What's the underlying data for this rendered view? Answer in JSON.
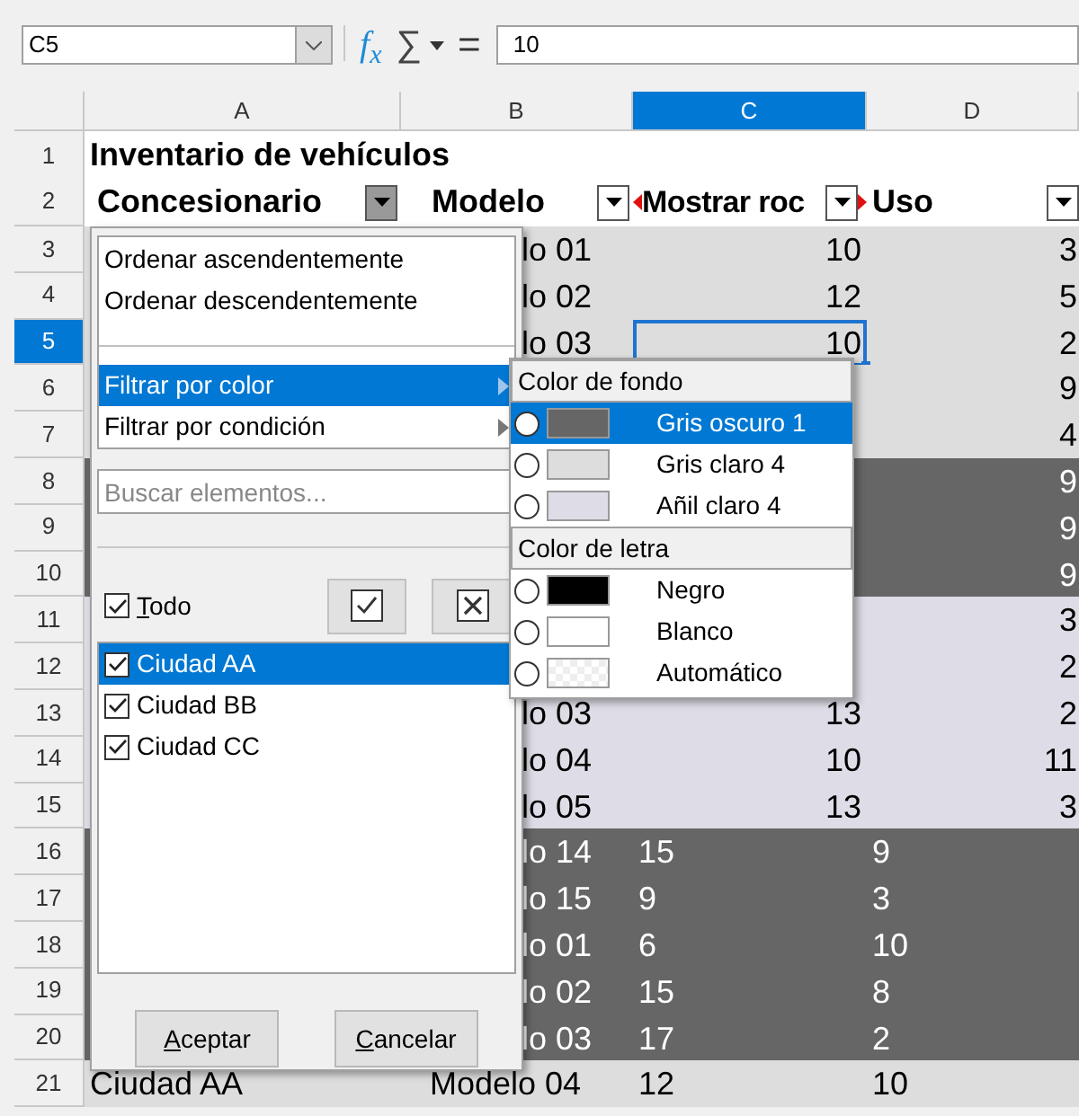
{
  "formula_bar": {
    "cell_ref": "C5",
    "function_label": "f$_{x}$",
    "sum_symbol": "∑",
    "equals_symbol": "=",
    "value": "10"
  },
  "columns": [
    {
      "label": "A",
      "selected": false
    },
    {
      "label": "B",
      "selected": false
    },
    {
      "label": "C",
      "selected": true
    },
    {
      "label": "D",
      "selected": false
    }
  ],
  "title_row": {
    "number": "1",
    "text": "Inventario de vehículos"
  },
  "header_row": {
    "number": "2",
    "headers": [
      {
        "label": "Concesionario",
        "filter_active": true
      },
      {
        "label": "Modelo",
        "filter_active": false
      },
      {
        "label": "Mostrar roc",
        "filter_active": false
      },
      {
        "label": "Uso",
        "filter_active": false
      }
    ]
  },
  "rows": [
    {
      "number": "3",
      "selected": false,
      "color": "#dddddd",
      "kind": "numeric",
      "cells": {
        "b": "lo 01",
        "c": "10",
        "d": "3"
      }
    },
    {
      "number": "4",
      "selected": false,
      "color": "#dddddd",
      "kind": "numeric",
      "cells": {
        "b": "lo 02",
        "c": "12",
        "d": "5"
      }
    },
    {
      "number": "5",
      "selected": true,
      "color": "#dddddd",
      "kind": "numeric",
      "cells": {
        "b": "lo 03",
        "c": "10",
        "d": "2"
      }
    },
    {
      "number": "6",
      "selected": false,
      "color": "#dddddd",
      "kind": "numeric",
      "cells": {
        "d": "9"
      }
    },
    {
      "number": "7",
      "selected": false,
      "color": "#dddddd",
      "kind": "numeric",
      "cells": {
        "d": "4"
      }
    },
    {
      "number": "8",
      "selected": false,
      "color": "#666666",
      "kind": "numeric",
      "cells": {
        "d": "9"
      }
    },
    {
      "number": "9",
      "selected": false,
      "color": "#666666",
      "kind": "numeric",
      "cells": {
        "d": "9"
      }
    },
    {
      "number": "10",
      "selected": false,
      "color": "#666666",
      "kind": "numeric",
      "cells": {
        "d": "9"
      }
    },
    {
      "number": "11",
      "selected": false,
      "color": "#dedce6",
      "kind": "numeric",
      "cells": {
        "d": "3"
      }
    },
    {
      "number": "12",
      "selected": false,
      "color": "#dedce6",
      "kind": "numeric",
      "cells": {
        "d": "2"
      }
    },
    {
      "number": "13",
      "selected": false,
      "color": "#dedce6",
      "kind": "numeric",
      "cells": {
        "b": "lo 03",
        "c": "13",
        "d": "2"
      }
    },
    {
      "number": "14",
      "selected": false,
      "color": "#dedce6",
      "kind": "numeric",
      "cells": {
        "b": "lo 04",
        "c": "10",
        "d": "11"
      }
    },
    {
      "number": "15",
      "selected": false,
      "color": "#dedce6",
      "kind": "numeric",
      "cells": {
        "b": "lo 05",
        "c": "13",
        "d": "3"
      }
    },
    {
      "number": "16",
      "selected": false,
      "color": "#666666",
      "kind": "text",
      "cells": {
        "b": "lo 14",
        "c": "15",
        "d": "9"
      }
    },
    {
      "number": "17",
      "selected": false,
      "color": "#666666",
      "kind": "text",
      "cells": {
        "b": "lo 15",
        "c": "9",
        "d": "3"
      }
    },
    {
      "number": "18",
      "selected": false,
      "color": "#666666",
      "kind": "text",
      "cells": {
        "b": "lo 01",
        "c": "6",
        "d": "10"
      }
    },
    {
      "number": "19",
      "selected": false,
      "color": "#666666",
      "kind": "text",
      "cells": {
        "b": "lo 02",
        "c": "15",
        "d": "8"
      }
    },
    {
      "number": "20",
      "selected": false,
      "color": "#666666",
      "kind": "text",
      "cells": {
        "b": "lo 03",
        "c": "17",
        "d": "2"
      }
    },
    {
      "number": "21",
      "selected": false,
      "color": "#dddddd",
      "kind": "text",
      "cells": {
        "a": "Ciudad AA",
        "b": "Modelo 04",
        "c": "12",
        "d": "10"
      }
    }
  ],
  "filter_popup": {
    "sort_items": [
      {
        "label": "Ordenar ascendentemente",
        "selected": false
      },
      {
        "label": "Ordenar descendentemente",
        "selected": false
      }
    ],
    "filter_items": [
      {
        "label": "Filtrar por color",
        "selected": true
      },
      {
        "label": "Filtrar por condición",
        "selected": false
      }
    ],
    "search": {
      "placeholder": "Buscar elementos..."
    },
    "select_all": {
      "label": "Todo",
      "checked": true
    },
    "items": [
      {
        "label": "Ciudad AA",
        "checked": true,
        "selected": true
      },
      {
        "label": "Ciudad BB",
        "checked": true,
        "selected": false
      },
      {
        "label": "Ciudad CC",
        "checked": true,
        "selected": false
      }
    ],
    "buttons": [
      "Aceptar",
      "Cancelar"
    ]
  },
  "color_submenu": {
    "groups": [
      {
        "title": "Color de fondo",
        "options": [
          {
            "label": "Gris oscuro 1",
            "kind": "swatch",
            "color": "#666666",
            "selected": true
          },
          {
            "label": "Gris claro 4",
            "kind": "swatch",
            "color": "#dddddd",
            "selected": false
          },
          {
            "label": "Añil claro 4",
            "kind": "swatch",
            "color": "#dedce6",
            "selected": false
          }
        ]
      },
      {
        "title": "Color de letra",
        "options": [
          {
            "label": "Negro",
            "kind": "swatch",
            "color": "#000000",
            "selected": false
          },
          {
            "label": "Blanco",
            "kind": "swatch",
            "color": "#ffffff",
            "selected": false
          },
          {
            "label": "Automático",
            "kind": "automatic",
            "selected": false
          }
        ]
      }
    ]
  }
}
